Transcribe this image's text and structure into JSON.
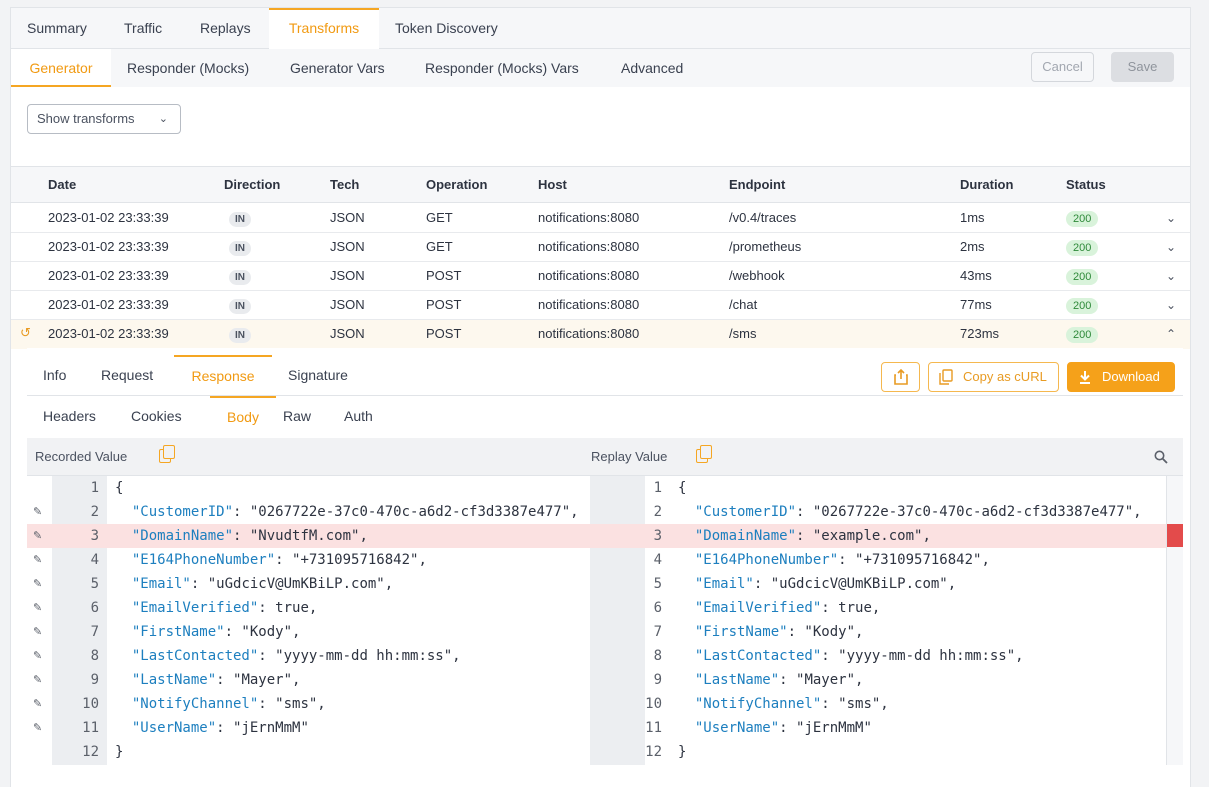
{
  "top_tabs": [
    "Summary",
    "Traffic",
    "Replays",
    "Transforms",
    "Token Discovery"
  ],
  "sub_tabs": [
    "Generator",
    "Responder (Mocks)",
    "Generator Vars",
    "Responder (Mocks) Vars",
    "Advanced"
  ],
  "actions": {
    "cancel": "Cancel",
    "save": "Save"
  },
  "show_transforms": "Show transforms",
  "table": {
    "headers": [
      "Date",
      "Direction",
      "Tech",
      "Operation",
      "Host",
      "Endpoint",
      "Duration",
      "Status"
    ],
    "rows": [
      {
        "date": "2023-01-02 23:33:39",
        "direction": "IN",
        "tech": "JSON",
        "operation": "GET",
        "host": "notifications:8080",
        "endpoint": "/v0.4/traces",
        "duration": "1ms",
        "status": "200"
      },
      {
        "date": "2023-01-02 23:33:39",
        "direction": "IN",
        "tech": "JSON",
        "operation": "GET",
        "host": "notifications:8080",
        "endpoint": "/prometheus",
        "duration": "2ms",
        "status": "200"
      },
      {
        "date": "2023-01-02 23:33:39",
        "direction": "IN",
        "tech": "JSON",
        "operation": "POST",
        "host": "notifications:8080",
        "endpoint": "/webhook",
        "duration": "43ms",
        "status": "200"
      },
      {
        "date": "2023-01-02 23:33:39",
        "direction": "IN",
        "tech": "JSON",
        "operation": "POST",
        "host": "notifications:8080",
        "endpoint": "/chat",
        "duration": "77ms",
        "status": "200"
      },
      {
        "date": "2023-01-02 23:33:39",
        "direction": "IN",
        "tech": "JSON",
        "operation": "POST",
        "host": "notifications:8080",
        "endpoint": "/sms",
        "duration": "723ms",
        "status": "200"
      }
    ]
  },
  "detail": {
    "tabs": [
      "Info",
      "Request",
      "Response",
      "Signature"
    ],
    "copy_curl": "Copy as cURL",
    "download": "Download",
    "body_tabs": [
      "Headers",
      "Cookies",
      "Body",
      "Raw",
      "Auth"
    ],
    "recorded_label": "Recorded Value",
    "replay_label": "Replay Value"
  },
  "diff": {
    "line_numbers": [
      "1",
      "2",
      "3",
      "4",
      "5",
      "6",
      "7",
      "8",
      "9",
      "10",
      "11",
      "12"
    ],
    "changed_line": 3,
    "recorded": [
      {
        "key": "",
        "rest": "{"
      },
      {
        "key": "\"CustomerID\"",
        "rest": ": \"0267722e-37c0-470c-a6d2-cf3d3387e477\","
      },
      {
        "key": "\"DomainName\"",
        "rest": ": \"NvudtfM.com\","
      },
      {
        "key": "\"E164PhoneNumber\"",
        "rest": ": \"+731095716842\","
      },
      {
        "key": "\"Email\"",
        "rest": ": \"uGdcicV@UmKBiLP.com\","
      },
      {
        "key": "\"EmailVerified\"",
        "rest": ": true,"
      },
      {
        "key": "\"FirstName\"",
        "rest": ": \"Kody\","
      },
      {
        "key": "\"LastContacted\"",
        "rest": ": \"yyyy-mm-dd hh:mm:ss\","
      },
      {
        "key": "\"LastName\"",
        "rest": ": \"Mayer\","
      },
      {
        "key": "\"NotifyChannel\"",
        "rest": ": \"sms\","
      },
      {
        "key": "\"UserName\"",
        "rest": ": \"jErnMmM\""
      },
      {
        "key": "",
        "rest": "}"
      }
    ],
    "replay": [
      {
        "key": "",
        "rest": "{"
      },
      {
        "key": "\"CustomerID\"",
        "rest": ": \"0267722e-37c0-470c-a6d2-cf3d3387e477\","
      },
      {
        "key": "\"DomainName\"",
        "rest": ": \"example.com\","
      },
      {
        "key": "\"E164PhoneNumber\"",
        "rest": ": \"+731095716842\","
      },
      {
        "key": "\"Email\"",
        "rest": ": \"uGdcicV@UmKBiLP.com\","
      },
      {
        "key": "\"EmailVerified\"",
        "rest": ": true,"
      },
      {
        "key": "\"FirstName\"",
        "rest": ": \"Kody\","
      },
      {
        "key": "\"LastContacted\"",
        "rest": ": \"yyyy-mm-dd hh:mm:ss\","
      },
      {
        "key": "\"LastName\"",
        "rest": ": \"Mayer\","
      },
      {
        "key": "\"NotifyChannel\"",
        "rest": ": \"sms\","
      },
      {
        "key": "\"UserName\"",
        "rest": ": \"jErnMmM\""
      },
      {
        "key": "",
        "rest": "}"
      }
    ]
  }
}
